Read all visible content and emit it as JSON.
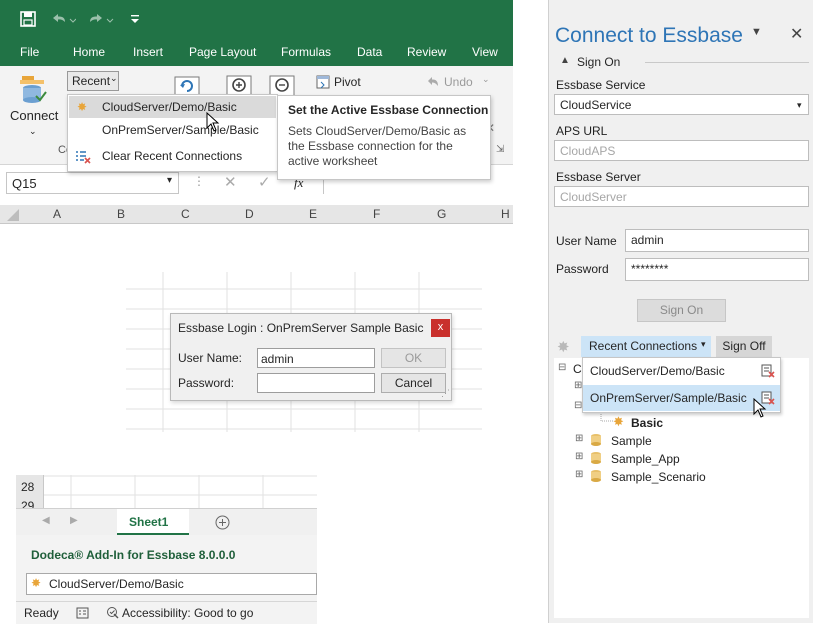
{
  "excel": {
    "tabs": [
      "File",
      "Home",
      "Insert",
      "Page Layout",
      "Formulas",
      "Data",
      "Review",
      "View"
    ],
    "ribbon": {
      "connect_label": "Connect",
      "recent_label": "Recent",
      "pivot_label": "Pivot",
      "undo_label": "Undo",
      "group_label_partial": "Co"
    },
    "recent_menu": {
      "items": [
        "CloudServer/Demo/Basic",
        "OnPremServer/Sample/Basic",
        "Clear Recent Connections"
      ]
    },
    "tooltip": {
      "title": "Set the Active Essbase Connection",
      "line1": "Sets CloudServer/Demo/Basic as",
      "line2": "the Essbase connection for the",
      "line3": "active worksheet"
    },
    "name_box": "Q15",
    "formula_fx": "fx",
    "columns": [
      "A",
      "B",
      "C",
      "D",
      "E",
      "F",
      "G",
      "H"
    ],
    "login_dialog": {
      "title": "Essbase Login : OnPremServer Sample Basic",
      "user_label": "User Name:",
      "user_value": "admin",
      "password_label": "Password:",
      "ok_label": "OK",
      "cancel_label": "Cancel",
      "close_label": "x"
    },
    "rows": [
      "28",
      "29"
    ],
    "sheet_tab": "Sheet1",
    "addin_title": "Dodeca® Add-In for Essbase 8.0.0.0",
    "addin_connection": "CloudServer/Demo/Basic",
    "status": {
      "ready": "Ready",
      "accessibility": "Accessibility: Good to go"
    }
  },
  "panel": {
    "title": "Connect to Essbase",
    "section": "Sign On",
    "service_label": "Essbase Service",
    "service_value": "CloudService",
    "aps_label": "APS URL",
    "aps_placeholder": "CloudAPS",
    "server_label": "Essbase Server",
    "server_placeholder": "CloudServer",
    "user_label": "User Name",
    "user_value": "admin",
    "password_label": "Password",
    "password_value": "********",
    "signon_button": "Sign On",
    "recent_button": "Recent Connections",
    "signoff_button": "Sign Off",
    "recent_items": [
      "CloudServer/Demo/Basic",
      "OnPremServer/Sample/Basic"
    ],
    "tree": {
      "root_partial": "C",
      "basic": "Basic",
      "apps": [
        "Sample",
        "Sample_App",
        "Sample_Scenario"
      ]
    }
  },
  "colors": {
    "excel_green": "#217346",
    "panel_title": "#2e75b6",
    "highlight": "#dadada",
    "selected_blue": "#cce4f7"
  }
}
